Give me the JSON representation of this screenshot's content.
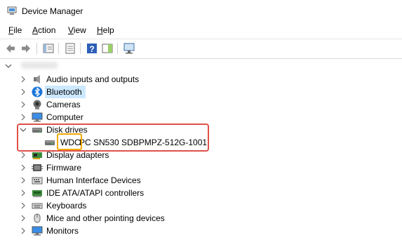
{
  "window": {
    "title": "Device Manager",
    "icon": "device-manager-icon"
  },
  "menu": [
    {
      "label": "File",
      "key": "F",
      "rest": "ile"
    },
    {
      "label": "Action",
      "key": "A",
      "rest": "ction"
    },
    {
      "label": "View",
      "key": "V",
      "rest": "iew"
    },
    {
      "label": "Help",
      "key": "H",
      "rest": "elp"
    }
  ],
  "toolbar": [
    "back-icon",
    "forward-icon",
    "properties-icon",
    "console-tree-icon",
    "help-icon",
    "action-pane-icon",
    "scan-hardware-icon"
  ],
  "tree": {
    "categories": [
      {
        "label": "Audio inputs and outputs",
        "icon": "speaker-icon",
        "expanded": false
      },
      {
        "label": "Bluetooth",
        "icon": "bluetooth-icon",
        "expanded": false,
        "selected": true
      },
      {
        "label": "Cameras",
        "icon": "camera-icon",
        "expanded": false
      },
      {
        "label": "Computer",
        "icon": "computer-icon",
        "expanded": false
      },
      {
        "label": "Disk drives",
        "icon": "disk-drive-icon",
        "expanded": true
      },
      {
        "label": "Display adapters",
        "icon": "display-adapter-icon",
        "expanded": false
      },
      {
        "label": "Firmware",
        "icon": "firmware-icon",
        "expanded": false
      },
      {
        "label": "Human Interface Devices",
        "icon": "hid-icon",
        "expanded": false
      },
      {
        "label": "IDE ATA/ATAPI controllers",
        "icon": "ide-controller-icon",
        "expanded": false
      },
      {
        "label": "Keyboards",
        "icon": "keyboard-icon",
        "expanded": false
      },
      {
        "label": "Mice and other pointing devices",
        "icon": "mouse-icon",
        "expanded": false
      },
      {
        "label": "Monitors",
        "icon": "monitor-icon",
        "expanded": false
      }
    ],
    "disk_child": {
      "prefix": "WDC",
      "rest": " PC SN530 SDBPMPZ-512G-1001",
      "icon": "disk-drive-icon"
    }
  },
  "colors": {
    "highlight_red": "#e0504a",
    "highlight_yellow": "#f2a900",
    "selection": "#cce8ff",
    "bluetooth": "#1a74d9"
  }
}
